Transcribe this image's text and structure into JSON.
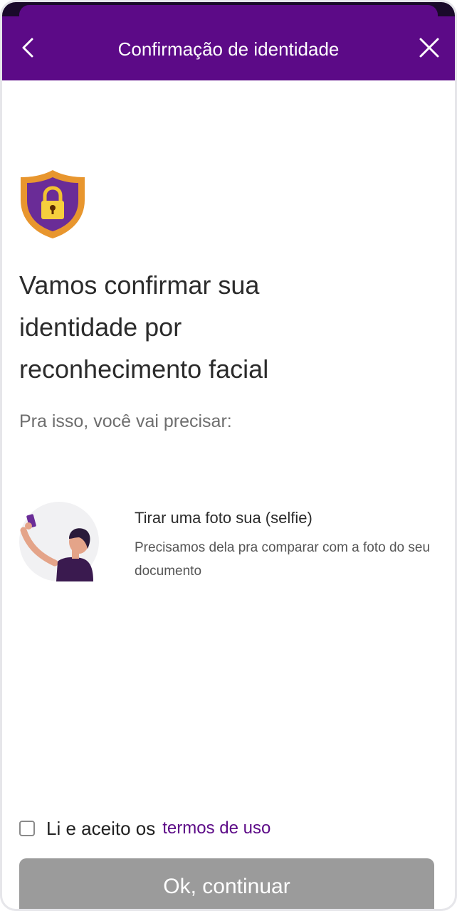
{
  "header": {
    "title": "Confirmação de identidade",
    "back_icon": "chevron-left-icon",
    "close_icon": "close-icon",
    "background_color": "#5c0a87"
  },
  "intro": {
    "icon": "shield-lock-icon",
    "headline_lines": [
      "Vamos confirmar sua",
      "identidade por",
      "reconhecimento facial"
    ],
    "subtitle": "Pra isso, você vai precisar:"
  },
  "requirements": [
    {
      "icon": "selfie-illustration",
      "title": "Tirar uma foto sua (selfie)",
      "description": "Precisamos dela pra comparar com a foto do seu documento"
    }
  ],
  "terms": {
    "checked": false,
    "label": "Li e aceito os",
    "link_text": "termos de uso"
  },
  "cta": {
    "label": "Ok, continuar",
    "enabled": false
  }
}
